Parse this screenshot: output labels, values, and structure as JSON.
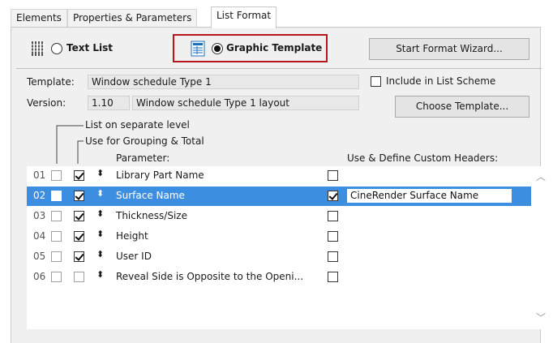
{
  "tabs": [
    {
      "label": "Elements"
    },
    {
      "label": "Properties & Parameters"
    },
    {
      "label": "List Format"
    }
  ],
  "format": {
    "text_list_label": "Text List",
    "graphic_template_label": "Graphic Template",
    "selected": "Graphic Template",
    "wizard_button": "Start Format Wizard...",
    "highlight_color": "#b5161d"
  },
  "template": {
    "template_label": "Template:",
    "template_value": "Window schedule Type 1",
    "version_label": "Version:",
    "version_value": "1.10",
    "version_desc": "Window schedule Type 1 layout",
    "include_label": "Include in List Scheme",
    "choose_button": "Choose Template..."
  },
  "list": {
    "separate_level_label": "List on separate level",
    "grouping_label": "Use for Grouping & Total",
    "parameter_header": "Parameter:",
    "custom_headers_header": "Use & Define Custom Headers:",
    "selection_color": "#3c8fe0",
    "rows": [
      {
        "num": "01",
        "separate": false,
        "grouping": true,
        "name": "Library Part Name",
        "custom": false,
        "header": ""
      },
      {
        "num": "02",
        "separate": false,
        "grouping": true,
        "name": "Surface Name",
        "custom": true,
        "header": "CineRender Surface Name",
        "selected": true
      },
      {
        "num": "03",
        "separate": false,
        "grouping": true,
        "name": "Thickness/Size",
        "custom": false,
        "header": ""
      },
      {
        "num": "04",
        "separate": false,
        "grouping": true,
        "name": "Height",
        "custom": false,
        "header": ""
      },
      {
        "num": "05",
        "separate": false,
        "grouping": true,
        "name": "User ID",
        "custom": false,
        "header": ""
      },
      {
        "num": "06",
        "separate": false,
        "grouping": false,
        "name": "Reveal Side is Opposite to the Openi...",
        "custom": false,
        "header": ""
      }
    ]
  }
}
